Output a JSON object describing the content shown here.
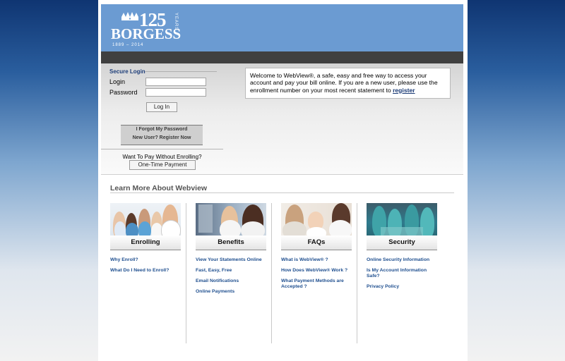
{
  "brand": {
    "number": "125",
    "years_vertical": "YEARS",
    "name": "BORGESS",
    "year_range": "1889 – 2014"
  },
  "login": {
    "title": "Secure Login",
    "login_label": "Login",
    "password_label": "Password",
    "login_value": "",
    "password_value": "",
    "login_button": "Log In",
    "forgot_password": "I Forgot My Password",
    "register_now": "New User? Register Now",
    "pay_prompt": "Want To Pay Without Enrolling?",
    "one_time_button": "One-Time Payment"
  },
  "welcome": {
    "text": "Welcome to WebView®, a safe, easy and free way to access your account and pay your bill online. If you are a new user, please use the enrollment number on your most recent statement to ",
    "link": "register"
  },
  "learn": {
    "title": "Learn More About Webview",
    "sections": [
      {
        "caption": "Enrolling",
        "links": [
          "Why Enroll?",
          "What Do I Need to Enroll?"
        ]
      },
      {
        "caption": "Benefits",
        "links": [
          "View Your Statements Online",
          "Fast, Easy, Free",
          "Email Notifications",
          "Online Payments"
        ]
      },
      {
        "caption": "FAQs",
        "links": [
          "What is WebView® ?",
          "How Does WebView® Work ?",
          "What Payment Methods are Accepted ?"
        ]
      },
      {
        "caption": "Security",
        "links": [
          "Online Security Information",
          "Is My Account Information Safe?",
          "Privacy Policy"
        ]
      }
    ]
  },
  "colors": {
    "header_blue": "#6b9bd2",
    "link_blue": "#1f4f8f",
    "dark_bar": "#404040"
  }
}
